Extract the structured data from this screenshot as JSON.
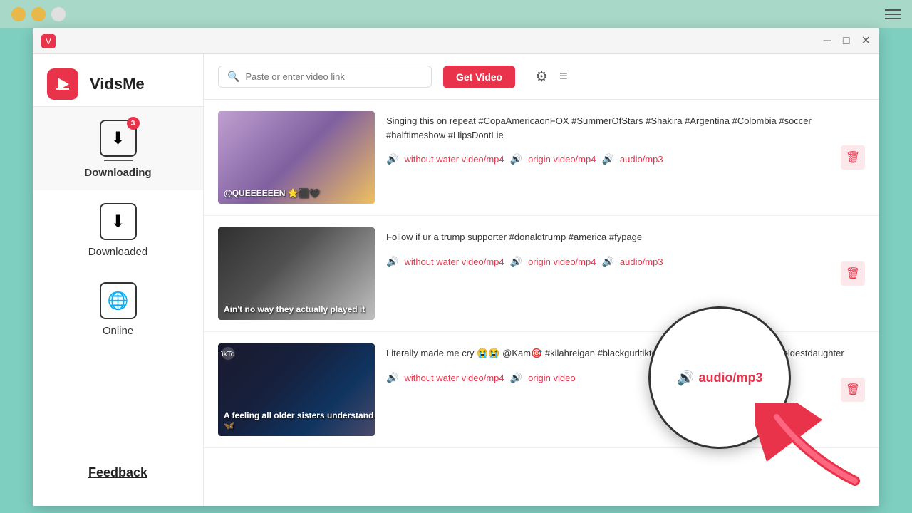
{
  "titleBar": {
    "menuLabel": "Menu"
  },
  "window": {
    "minimize": "─",
    "maximize": "□",
    "close": "✕",
    "appIconLabel": "V"
  },
  "header": {
    "appName": "VidsMe",
    "searchPlaceholder": "Paste or enter video link",
    "getVideoBtn": "Get Video",
    "settingsIcon": "⚙",
    "menuIcon": "≡"
  },
  "sidebar": {
    "downloadingLabel": "Downloading",
    "downloadingBadge": "3",
    "downloadedLabel": "Downloaded",
    "onlineLabel": "Online",
    "feedbackLabel": "Feedback"
  },
  "videos": [
    {
      "id": 1,
      "title": "Singing this on repeat #CopaAmericaonFOX #SummerOfStars #Shakira #Argentina #Colombia #soccer #halftimeshow #HipsDontLie",
      "thumbText": "@QUEEEEEEN 🌟⬛🖤",
      "thumbClass": "thumb-1",
      "formats": [
        "without water video/mp4",
        "origin video/mp4",
        "audio/mp3"
      ]
    },
    {
      "id": 2,
      "title": "Follow if ur a trump supporter #donaldtrump #america #fypage",
      "thumbText": "Ain't no way they actually played it",
      "thumbClass": "thumb-2",
      "formats": [
        "without water video/mp4",
        "origin video/mp4",
        "audio/mp3"
      ]
    },
    {
      "id": 3,
      "title": "Literally made me cry 😭😭 @Kam🎯 #kilahreigan #blackgurltiktok #blackgirltiktok #oldersister #oldestdaughter",
      "thumbText": "A feeling all older sisters understand 🦋",
      "thumbClass": "thumb-3",
      "formats": [
        "without water video/mp4",
        "origin video",
        "audio/mp3"
      ]
    }
  ],
  "magnifier": {
    "icon": "🔊",
    "text": "audio/mp3"
  },
  "colors": {
    "accent": "#e8334a",
    "bg": "#7ecfc0",
    "sidebar": "#ffffff",
    "border": "#e8e8e8"
  }
}
